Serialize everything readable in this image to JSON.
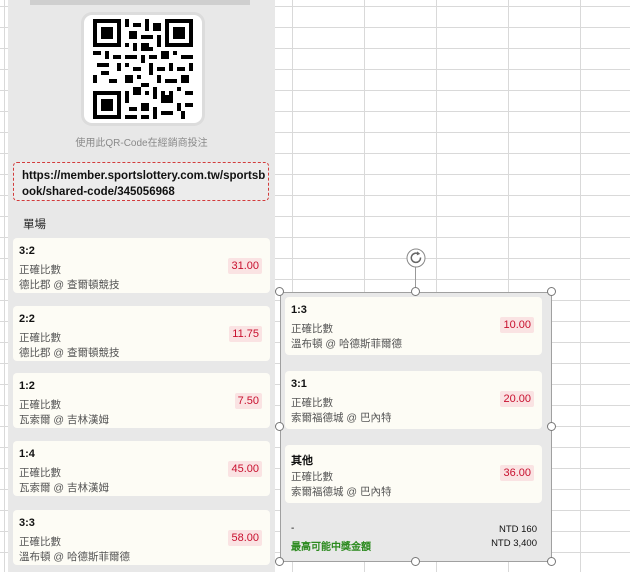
{
  "qr": {
    "caption": "使用此QR-Code在經銷商投注"
  },
  "share": {
    "url": "https://member.sportslottery.com.tw/sportsbook/shared-code/345056968"
  },
  "section": {
    "label": "單場"
  },
  "left_bets": [
    {
      "score": "3:2",
      "market": "正確比數",
      "match": "德比郡 @ 查爾頓競技",
      "odds": "31.00"
    },
    {
      "score": "2:2",
      "market": "正確比數",
      "match": "德比郡 @ 查爾頓競技",
      "odds": "11.75"
    },
    {
      "score": "1:2",
      "market": "正確比數",
      "match": "瓦索爾 @ 吉林漢姆",
      "odds": "7.50"
    },
    {
      "score": "1:4",
      "market": "正確比數",
      "match": "瓦索爾 @ 吉林漢姆",
      "odds": "45.00"
    },
    {
      "score": "3:3",
      "market": "正確比數",
      "match": "溫布頓 @ 哈德斯菲爾德",
      "odds": "58.00"
    }
  ],
  "right_bets": [
    {
      "score": "1:3",
      "market": "正確比數",
      "match": "溫布頓 @ 哈德斯菲爾德",
      "odds": "10.00"
    },
    {
      "score": "3:1",
      "market": "正確比數",
      "match": "索爾福德城 @ 巴內特",
      "odds": "20.00"
    },
    {
      "score": "其他",
      "market": "正確比數",
      "match": "索爾福德城 @ 巴內特",
      "odds": "36.00"
    }
  ],
  "footer": {
    "dash": "-",
    "max_label": "最高可能中獎金額",
    "stake": "NTD 160",
    "max_win": "NTD 3,400"
  },
  "colors": {
    "odds_text": "#c8102e",
    "odds_bg": "#fae3e3",
    "win_label": "#2b8a1e",
    "dashed_border": "#d23b3b"
  },
  "icons": {
    "rotate": "rotate-icon",
    "qr": "qr-code-icon"
  }
}
